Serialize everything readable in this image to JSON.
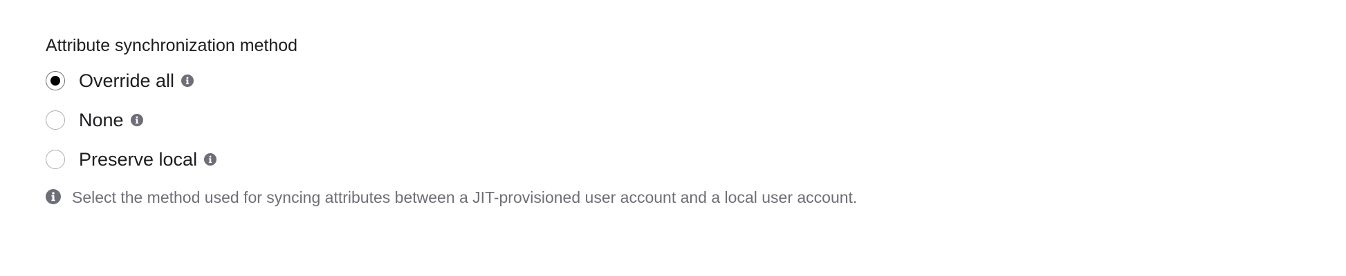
{
  "field": {
    "label": "Attribute synchronization method"
  },
  "options": [
    {
      "label": "Override all",
      "checked": true,
      "icon": "info-icon"
    },
    {
      "label": "None",
      "checked": false,
      "icon": "info-icon"
    },
    {
      "label": "Preserve local",
      "checked": false,
      "icon": "info-icon"
    }
  ],
  "help": {
    "icon": "info-icon",
    "text": "Select the method used for syncing attributes between a JIT-provisioned user account and a local user account."
  },
  "colors": {
    "selected_dot": "#000000",
    "info_icon": "#6e6e78",
    "help_text": "#6e6e78",
    "label_text": "#1d1d21"
  }
}
